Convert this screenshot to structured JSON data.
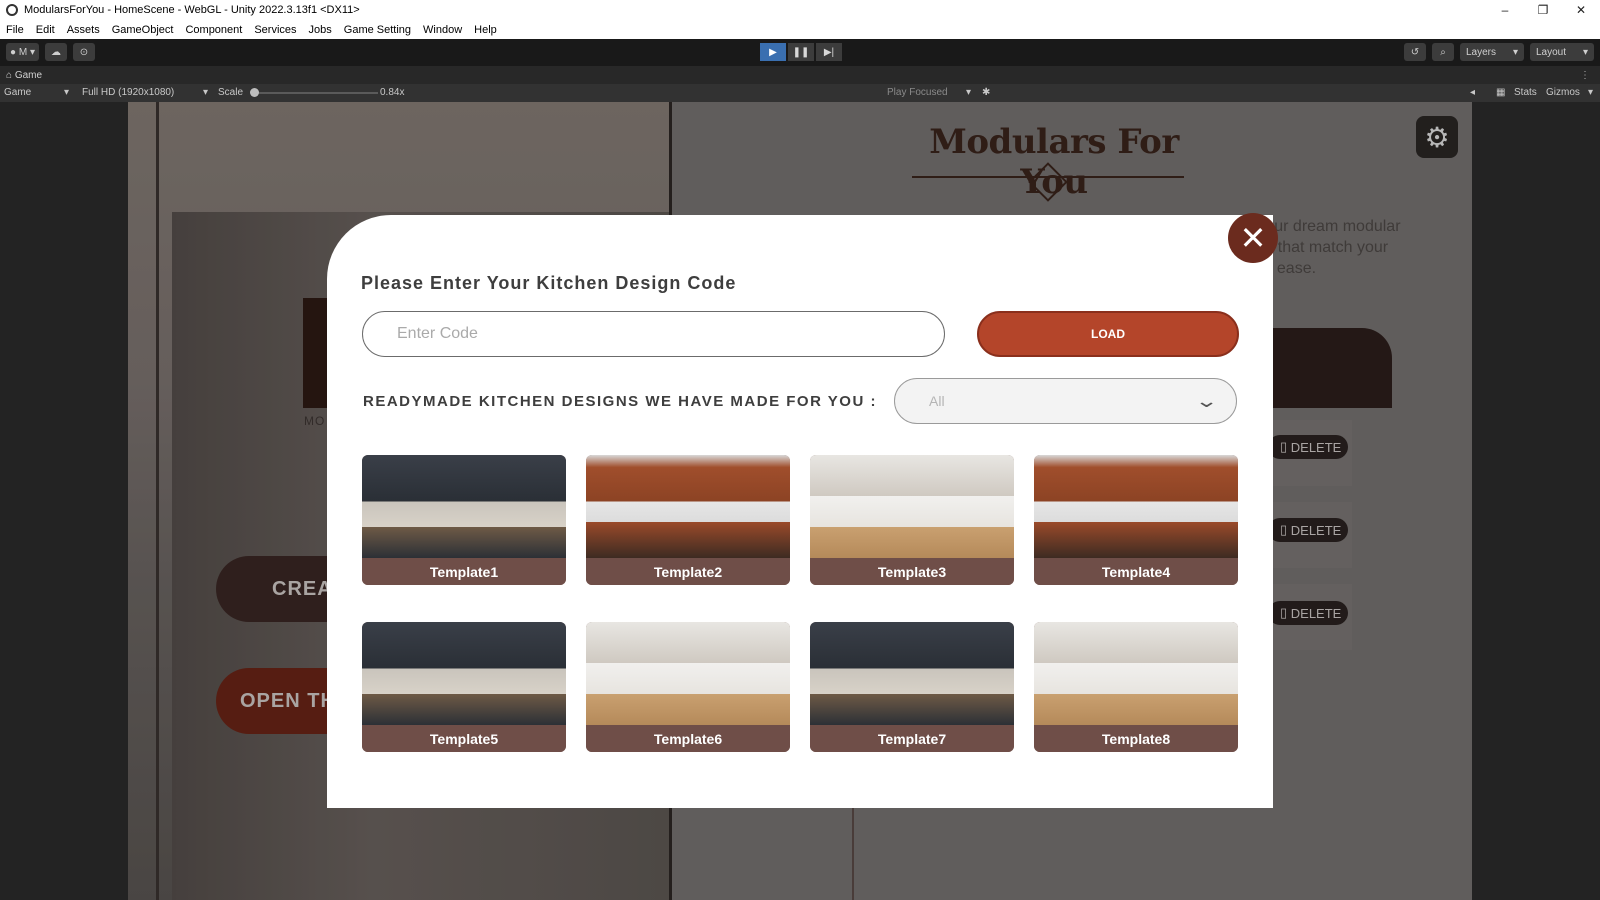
{
  "window": {
    "title": "ModularsForYou - HomeScene - WebGL - Unity 2022.3.13f1 <DX11>",
    "minimize": "–",
    "restore": "❐",
    "close": "✕"
  },
  "menu": [
    "File",
    "Edit",
    "Assets",
    "GameObject",
    "Component",
    "Services",
    "Jobs",
    "Game Setting",
    "Window",
    "Help"
  ],
  "toolbar": {
    "account_label": "M",
    "play_icon": "▶",
    "pause_icon": "❚❚",
    "step_icon": "▶|",
    "layers_label": "Layers",
    "layout_label": "Layout"
  },
  "game_tab": {
    "label": "Game",
    "menu_icon": "⋮"
  },
  "game_bar": {
    "display": "Game",
    "resolution": "Full HD (1920x1080)",
    "scale_label": "Scale",
    "scale_value": "0.84x",
    "play_mode": "Play Focused",
    "stats": "Stats",
    "gizmos": "Gizmos"
  },
  "scene": {
    "brand": "Modulars For You",
    "intro_lines": [
      "e your dream modular",
      "ions that match your",
      "with ease."
    ],
    "create_label": "CREA",
    "open_label": "OPEN TH",
    "mo_label": "MO",
    "delete_label": "DELETE",
    "gear_icon": "⚙"
  },
  "modal": {
    "title": "Please Enter Your Kitchen Design Code",
    "code_placeholder": "Enter Code",
    "code_value": "",
    "load_label": "LOAD",
    "readymade_label": "READYMADE KITCHEN DESIGNS WE HAVE MADE FOR YOU :",
    "filter_value": "All",
    "close_icon": "✕",
    "templates": [
      {
        "name": "Template1",
        "style": "dark"
      },
      {
        "name": "Template2",
        "style": "wood"
      },
      {
        "name": "Template3",
        "style": "white"
      },
      {
        "name": "Template4",
        "style": "wood"
      },
      {
        "name": "Template5",
        "style": "dark"
      },
      {
        "name": "Template6",
        "style": "white"
      },
      {
        "name": "Template7",
        "style": "dark"
      },
      {
        "name": "Template8",
        "style": "white"
      }
    ]
  },
  "colors": {
    "accent": "#b4452a",
    "close": "#6b2b1e",
    "caption": "#6f4e48"
  }
}
